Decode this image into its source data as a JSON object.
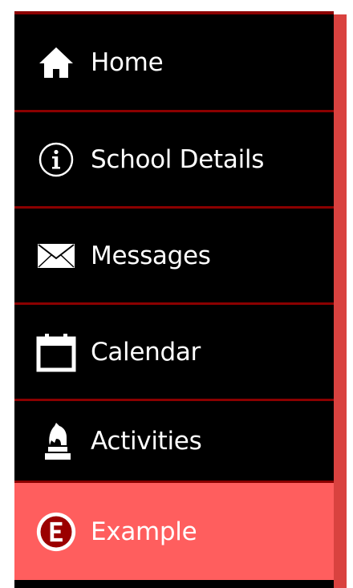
{
  "sidebar": {
    "items": [
      {
        "label": "Home",
        "icon": "home-icon"
      },
      {
        "label": "School Details",
        "icon": "info-icon"
      },
      {
        "label": "Messages",
        "icon": "envelope-icon"
      },
      {
        "label": "Calendar",
        "icon": "calendar-icon"
      },
      {
        "label": "Activities",
        "icon": "chess-knight-icon"
      },
      {
        "label": "Example",
        "icon": "letter-e-circle-icon",
        "active": true
      }
    ],
    "colors": {
      "background": "#000000",
      "divider": "#8b0000",
      "active_background": "#ff5e5e",
      "scrollbar": "#d9423f",
      "text": "#ffffff"
    }
  }
}
